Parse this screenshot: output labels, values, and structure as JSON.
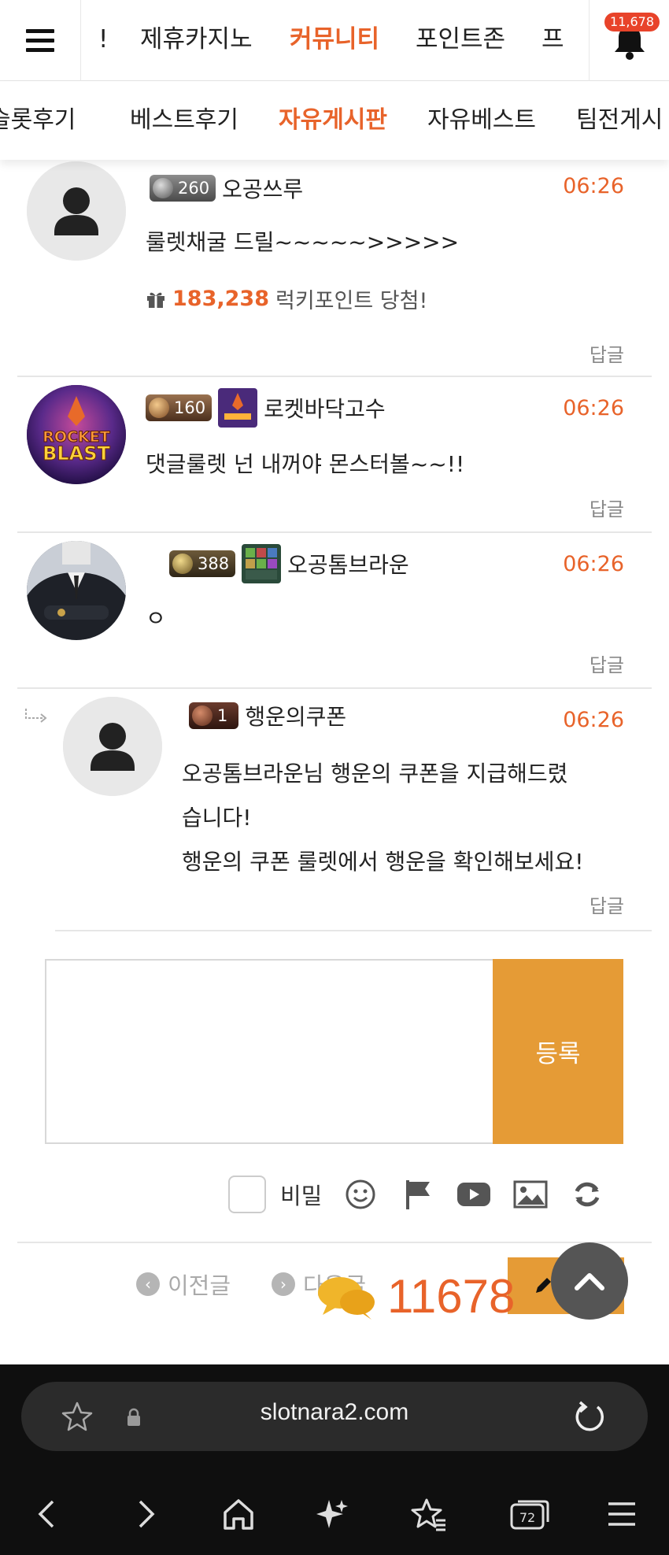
{
  "top_nav": {
    "items": [
      {
        "label": "!"
      },
      {
        "label": "제휴카지노"
      },
      {
        "label": "커뮤니티"
      },
      {
        "label": "포인트존"
      },
      {
        "label": "프"
      }
    ],
    "active_index": 2,
    "notification_count": "11,678"
  },
  "sub_nav": {
    "items": [
      {
        "label": "슬롯후기"
      },
      {
        "label": "베스트후기"
      },
      {
        "label": "자유게시판"
      },
      {
        "label": "자유베스트"
      },
      {
        "label": "팀전게시"
      }
    ],
    "active_index": 2
  },
  "comments": [
    {
      "level": "260",
      "username": "오공쓰루",
      "time": "06:26",
      "content": "룰렛채굴 드릴~~~~~>>>>>",
      "lucky_amount": "183,238",
      "lucky_text": "럭키포인트 당첨!",
      "reply": "답글"
    },
    {
      "level": "160",
      "username": "로켓바닥고수",
      "time": "06:26",
      "content": "댓글룰렛 넌 내꺼야 몬스터볼~~!!",
      "avatar_text_1": "ROCKET",
      "avatar_text_2": "BLAST",
      "reply": "답글"
    },
    {
      "level": "388",
      "username": "오공톰브라운",
      "time": "06:26",
      "content": "ㅇ",
      "reply": "답글"
    },
    {
      "level": "1",
      "username": "행운의쿠폰",
      "time": "06:26",
      "content_lines": [
        "오공톰브라운님 행운의 쿠폰을 지급해드렸",
        "습니다!",
        "행운의 쿠폰 룰렛에서 행운을 확인해보세요!"
      ],
      "reply": "답글"
    }
  ],
  "write_box": {
    "submit_label": "등록",
    "secret_label": "비밀"
  },
  "post_nav": {
    "prev_label": "이전글",
    "next_label": "다음글",
    "write_label": "쓰기",
    "chat_count": "11678"
  },
  "browser": {
    "url": "slotnara2.com",
    "tab_count": "72"
  },
  "colors": {
    "accent": "#e8632a",
    "button": "#e59b36"
  }
}
